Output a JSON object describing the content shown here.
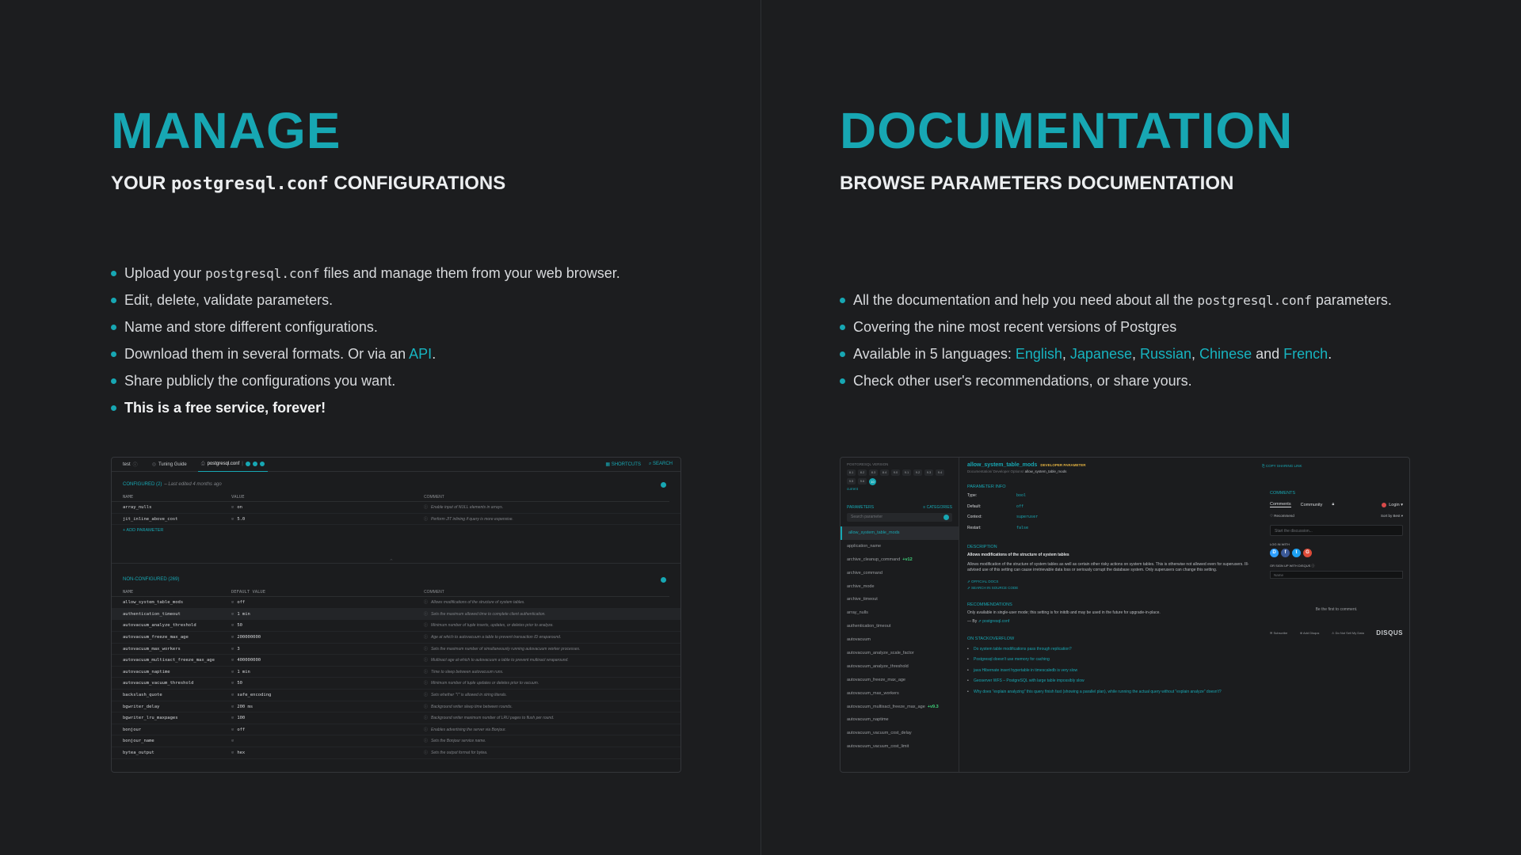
{
  "manage": {
    "title": "MANAGE",
    "subtitle_prefix": "YOUR",
    "subtitle_code": "postgresql.conf",
    "subtitle_suffix": "CONFIGURATIONS",
    "bullets": {
      "b1_pre": "Upload your",
      "b1_code": "postgresql.conf",
      "b1_post": "files and manage them from your web browser.",
      "b2": "Edit, delete, validate parameters.",
      "b3": "Name and store different configurations.",
      "b4_pre": "Download them in several formats. Or via an",
      "b4_link": "API",
      "b4_post": ".",
      "b5": "Share publicly the configurations you want.",
      "b6": "This is a free service, forever!"
    },
    "screenshot": {
      "tabs": [
        "test",
        "Tuning Guide",
        "postgresql.conf"
      ],
      "shortcuts": "SHORTCUTS",
      "search": "SEARCH",
      "configured_label": "CONFIGURED (2)",
      "configured_meta": "– Last edited 4 months ago",
      "columns": [
        "NAME",
        "VALUE",
        "COMMENT"
      ],
      "configured_rows": [
        {
          "name": "array_nulls",
          "value": "on",
          "comment": "Enable input of NULL elements in arrays."
        },
        {
          "name": "jit_inline_above_cost",
          "value": "5.0",
          "comment": "Perform JIT inlining if query is more expensive."
        }
      ],
      "add_param": "+ ADD PARAMETER",
      "nonconfigured_label": "NON-CONFIGURED (269)",
      "columns2": [
        "NAME",
        "DEFAULT VALUE",
        "COMMENT"
      ],
      "nonconfigured_rows": [
        {
          "name": "allow_system_table_mods",
          "value": "off",
          "comment": "Allows modifications of the structure of system tables."
        },
        {
          "name": "authentication_timeout",
          "value": "1 min",
          "comment": "Sets the maximum allowed time to complete client authentication."
        },
        {
          "name": "autovacuum_analyze_threshold",
          "value": "50",
          "comment": "Minimum number of tuple inserts, updates, or deletes prior to analyze."
        },
        {
          "name": "autovacuum_freeze_max_age",
          "value": "200000000",
          "comment": "Age at which to autovacuum a table to prevent transaction ID wraparound."
        },
        {
          "name": "autovacuum_max_workers",
          "value": "3",
          "comment": "Sets the maximum number of simultaneously running autovacuum worker processes."
        },
        {
          "name": "autovacuum_multixact_freeze_max_age",
          "value": "400000000",
          "comment": "Multixact age at which to autovacuum a table to prevent multixact wraparound."
        },
        {
          "name": "autovacuum_naptime",
          "value": "1 min",
          "comment": "Time to sleep between autovacuum runs."
        },
        {
          "name": "autovacuum_vacuum_threshold",
          "value": "50",
          "comment": "Minimum number of tuple updates or deletes prior to vacuum."
        },
        {
          "name": "backslash_quote",
          "value": "safe_encoding",
          "comment": "Sets whether \"\\'\" is allowed in string literals."
        },
        {
          "name": "bgwriter_delay",
          "value": "200 ms",
          "comment": "Background writer sleep time between rounds."
        },
        {
          "name": "bgwriter_lru_maxpages",
          "value": "100",
          "comment": "Background writer maximum number of LRU pages to flush per round."
        },
        {
          "name": "bonjour",
          "value": "off",
          "comment": "Enables advertising the server via Bonjour."
        },
        {
          "name": "bonjour_name",
          "value": "",
          "comment": "Sets the Bonjour service name."
        },
        {
          "name": "bytea_output",
          "value": "hex",
          "comment": "Sets the output format for bytea."
        }
      ]
    }
  },
  "documentation": {
    "title": "DOCUMENTATION",
    "subtitle": "BROWSE PARAMETERS DOCUMENTATION",
    "bullets": {
      "b1_pre": "All the documentation and help you need about all the",
      "b1_code": "postgresql.conf",
      "b1_post": "parameters.",
      "b2": "Covering the nine most recent versions of Postgres",
      "b3_pre": "Available in 5 languages:",
      "lang1": "English",
      "lang2": "Japanese",
      "lang3": "Russian",
      "lang4": "Chinese",
      "b3_and": "and",
      "lang5": "French",
      "b4": "Check other user's recommendations, or share yours."
    },
    "screenshot": {
      "version_label": "POSTGRESQL VERSION",
      "versions": [
        "8.1",
        "8.2",
        "8.3",
        "8.4",
        "9.0",
        "9.1",
        "9.2",
        "9.3",
        "9.4",
        "9.5",
        "9.6",
        "10"
      ],
      "current_label": "current",
      "params_label": "PARAMETERS",
      "categories_label": "≡ CATEGORIES",
      "search_placeholder": "Search parameter",
      "params": [
        {
          "name": "allow_system_table_mods",
          "new": ""
        },
        {
          "name": "application_name",
          "new": ""
        },
        {
          "name": "archive_cleanup_command",
          "new": "+v12"
        },
        {
          "name": "archive_command",
          "new": ""
        },
        {
          "name": "archive_mode",
          "new": ""
        },
        {
          "name": "archive_timeout",
          "new": ""
        },
        {
          "name": "array_nulls",
          "new": ""
        },
        {
          "name": "authentication_timeout",
          "new": ""
        },
        {
          "name": "autovacuum",
          "new": ""
        },
        {
          "name": "autovacuum_analyze_scale_factor",
          "new": ""
        },
        {
          "name": "autovacuum_analyze_threshold",
          "new": ""
        },
        {
          "name": "autovacuum_freeze_max_age",
          "new": ""
        },
        {
          "name": "autovacuum_max_workers",
          "new": ""
        },
        {
          "name": "autovacuum_multixact_freeze_max_age",
          "new": "+v9.3"
        },
        {
          "name": "autovacuum_naptime",
          "new": ""
        },
        {
          "name": "autovacuum_vacuum_cost_delay",
          "new": ""
        },
        {
          "name": "autovacuum_vacuum_cost_limit",
          "new": ""
        }
      ],
      "doc_title": "allow_system_table_mods",
      "doc_badge": "DEVELOPER PARAMETER",
      "breadcrumb_pre": "Documentation/ Developer Options/",
      "breadcrumb_cur": "allow_system_table_mods",
      "copy_link": "⎘ COPY SHARING LINK",
      "info_label": "PARAMETER INFO",
      "info": [
        {
          "k": "Type:",
          "v": "bool"
        },
        {
          "k": "Default:",
          "v": "off"
        },
        {
          "k": "Context:",
          "v": "superuser"
        },
        {
          "k": "Restart:",
          "v": "false"
        }
      ],
      "desc_label": "DESCRIPTION",
      "desc_bold": "Allows modifications of the structure of system tables",
      "desc_text": "Allows modification of the structure of system tables as well as certain other risky actions on system tables. This is otherwise not allowed even for superusers. Ill-advised use of this setting can cause irretrievable data loss or seriously corrupt the database system. Only superusers can change this setting.",
      "doc_link1": "⇗ OFFICIAL DOCS",
      "doc_link2": "⇗ SEARCH IN SOURCE CODE",
      "rec_label": "RECOMMENDATIONS",
      "rec_text": "Only available in single-user mode; this setting is for initdb and may be used in the future for upgrade-in-place.",
      "rec_by_pre": "— By",
      "rec_by_link": "⇗ postgresql.conf",
      "so_label": "ON STACKOVERFLOW",
      "so_items": [
        "Do system table modifications pass through replication?",
        "Postgresql doesn't use memory for caching",
        "java Hibernate insert hypertable in timescaledb is very slow",
        "Geoserver WFS – PostgreSQL with large table impossibly slow",
        "Why does \"explain analyzing\" this query finish fast (showing a parallel plan), while running the actual query without \"explain analyze\" doesn't?"
      ],
      "comments_label": "COMMENTS",
      "com_tab1": "Comments",
      "com_tab2": "Community",
      "login": "Login ▾",
      "recommend": "♡ Recommend",
      "sort": "Sort by Best ▾",
      "discussion_placeholder": "Start the discussion...",
      "log_in_with": "LOG IN WITH",
      "or_sign_up": "OR SIGN UP WITH DISQUS ⓘ",
      "name_placeholder": "Name",
      "first_comment": "Be the first to comment.",
      "footer1": "✉ Subscribe",
      "footer2": "⊕ Add Disqus",
      "footer3": "⚠ Do Not Sell My Data",
      "disqus": "DISQUS",
      "social": {
        "d": "D",
        "f": "f",
        "t": "t",
        "g": "G",
        "d_color": "#2e9fff",
        "f_color": "#3b5998",
        "t_color": "#1da1f2",
        "g_color": "#dd4b39"
      }
    }
  },
  "colors": {
    "accent": "#17a7b3",
    "background": "#1c1d1f"
  }
}
